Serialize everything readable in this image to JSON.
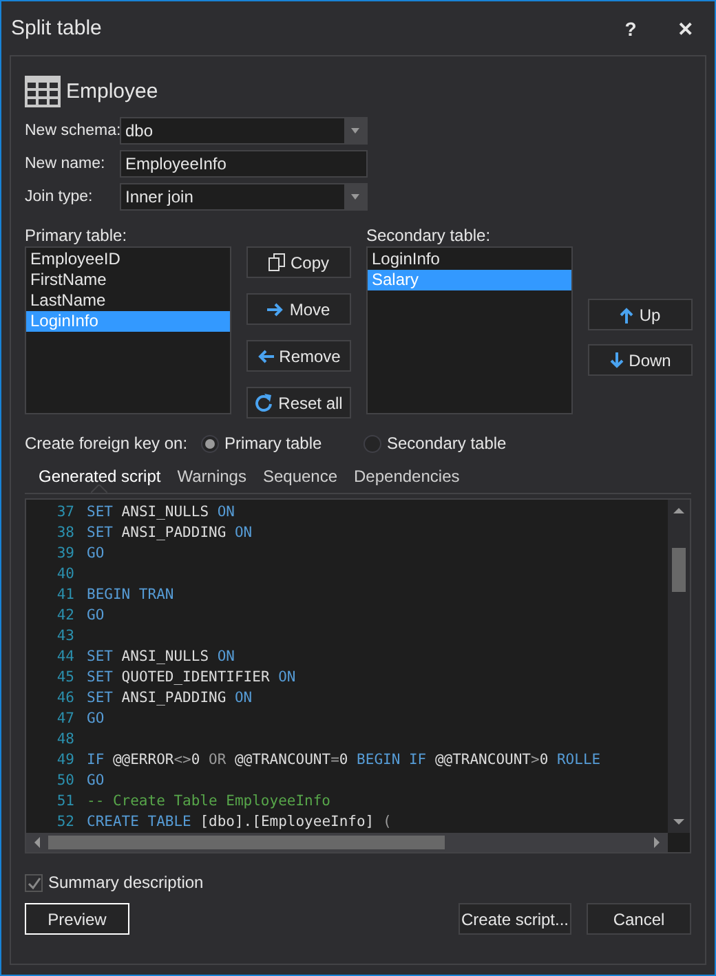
{
  "window": {
    "title": "Split table",
    "help": "?",
    "close": "✕"
  },
  "table_name": "Employee",
  "fields": [
    {
      "label": "New schema:",
      "value": "dbo",
      "kind": "dropdown"
    },
    {
      "label": "New name:",
      "value": "EmployeeInfo",
      "kind": "text"
    },
    {
      "label": "Join type:",
      "value": "Inner join",
      "kind": "dropdown"
    }
  ],
  "primary_table": {
    "label": "Primary table:",
    "items": [
      {
        "text": "EmployeeID",
        "selected": false
      },
      {
        "text": "FirstName",
        "selected": false
      },
      {
        "text": "LastName",
        "selected": false
      },
      {
        "text": "LoginInfo",
        "selected": true
      }
    ]
  },
  "transfer_buttons": [
    {
      "label": "Copy",
      "kind": "copy"
    },
    {
      "label": "Move",
      "kind": "right"
    },
    {
      "label": "Remove",
      "kind": "left"
    },
    {
      "label": "Reset all",
      "kind": "reset"
    }
  ],
  "secondary_table": {
    "label": "Secondary table:",
    "items": [
      {
        "text": "LoginInfo",
        "selected": false
      },
      {
        "text": "Salary",
        "selected": true
      }
    ]
  },
  "order_buttons": [
    {
      "label": "Up",
      "kind": "up"
    },
    {
      "label": "Down",
      "kind": "down"
    }
  ],
  "foreign_key": {
    "label": "Create foreign key on:",
    "options": [
      {
        "label": "Primary table",
        "selected": true
      },
      {
        "label": "Secondary table",
        "selected": false
      }
    ]
  },
  "tabs": [
    {
      "label": "Generated script",
      "selected": true
    },
    {
      "label": "Warnings",
      "selected": false
    },
    {
      "label": "Sequence",
      "selected": false
    },
    {
      "label": "Dependencies",
      "selected": false
    }
  ],
  "script": [
    {
      "number": "37",
      "tokens": [
        {
          "kind": "kw",
          "text": "SET "
        },
        {
          "kind": "id",
          "text": "ANSI_NULLS "
        },
        {
          "kind": "kw",
          "text": "ON"
        }
      ]
    },
    {
      "number": "38",
      "tokens": [
        {
          "kind": "kw",
          "text": "SET "
        },
        {
          "kind": "id",
          "text": "ANSI_PADDING "
        },
        {
          "kind": "kw",
          "text": "ON"
        }
      ]
    },
    {
      "number": "39",
      "tokens": [
        {
          "kind": "kw",
          "text": "GO"
        }
      ]
    },
    {
      "number": "40"
    },
    {
      "number": "41",
      "tokens": [
        {
          "kind": "kw",
          "text": "BEGIN TRAN"
        }
      ]
    },
    {
      "number": "42",
      "tokens": [
        {
          "kind": "kw",
          "text": "GO"
        }
      ]
    },
    {
      "number": "43"
    },
    {
      "number": "44",
      "tokens": [
        {
          "kind": "kw",
          "text": "SET "
        },
        {
          "kind": "id",
          "text": "ANSI_NULLS "
        },
        {
          "kind": "kw",
          "text": "ON"
        }
      ]
    },
    {
      "number": "45",
      "tokens": [
        {
          "kind": "kw",
          "text": "SET "
        },
        {
          "kind": "id",
          "text": "QUOTED_IDENTIFIER "
        },
        {
          "kind": "kw",
          "text": "ON"
        }
      ]
    },
    {
      "number": "46",
      "tokens": [
        {
          "kind": "kw",
          "text": "SET "
        },
        {
          "kind": "id",
          "text": "ANSI_PADDING "
        },
        {
          "kind": "kw",
          "text": "ON"
        }
      ]
    },
    {
      "number": "47",
      "tokens": [
        {
          "kind": "kw",
          "text": "GO"
        }
      ]
    },
    {
      "number": "48"
    },
    {
      "number": "49",
      "tokens": [
        {
          "kind": "kw",
          "text": "IF "
        },
        {
          "kind": "id",
          "text": "@@ERROR"
        },
        {
          "kind": "op",
          "text": "<>"
        },
        {
          "kind": "id",
          "text": "0 "
        },
        {
          "kind": "op",
          "text": "OR "
        },
        {
          "kind": "id",
          "text": "@@TRANCOUNT"
        },
        {
          "kind": "op",
          "text": "="
        },
        {
          "kind": "id",
          "text": "0 "
        },
        {
          "kind": "kw",
          "text": "BEGIN IF "
        },
        {
          "kind": "id",
          "text": "@@TRANCOUNT"
        },
        {
          "kind": "op",
          "text": ">"
        },
        {
          "kind": "id",
          "text": "0 "
        },
        {
          "kind": "kw",
          "text": "ROLLE"
        }
      ]
    },
    {
      "number": "50",
      "tokens": [
        {
          "kind": "kw",
          "text": "GO"
        }
      ]
    },
    {
      "number": "51",
      "tokens": [
        {
          "kind": "cm",
          "text": "-- Create Table EmployeeInfo"
        }
      ]
    },
    {
      "number": "52",
      "tokens": [
        {
          "kind": "kw",
          "text": "CREATE TABLE "
        },
        {
          "kind": "id",
          "text": "[dbo].[EmployeeInfo] "
        },
        {
          "kind": "op",
          "text": "("
        }
      ]
    }
  ],
  "summary": {
    "label": "Summary description",
    "checked": true
  },
  "buttons": [
    {
      "label": "Preview",
      "focused": true
    },
    {
      "label": "Create script...",
      "focused": false
    },
    {
      "label": "Cancel",
      "focused": false
    }
  ]
}
